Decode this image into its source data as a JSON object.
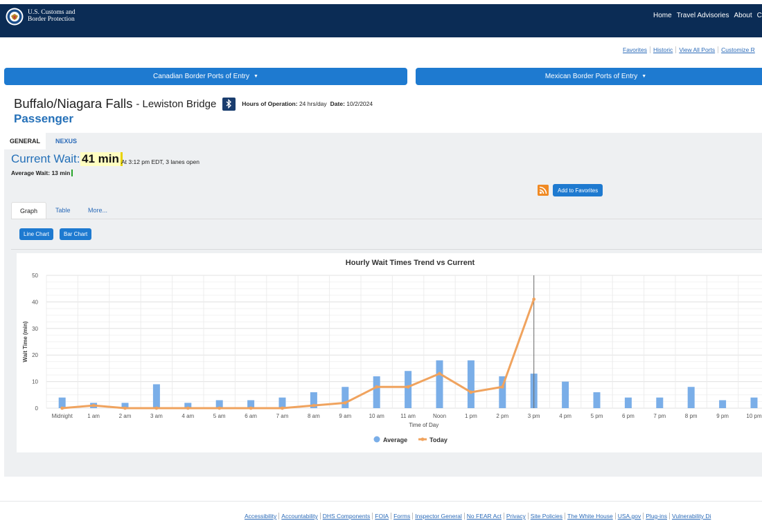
{
  "header": {
    "brand_line1": "U.S. Customs and",
    "brand_line2": "Border Protection",
    "nav": [
      "Home",
      "Travel Advisories",
      "About",
      "Co"
    ]
  },
  "utility_links": [
    "Favorites",
    "Historic",
    "View All Ports",
    "Customize R"
  ],
  "port_bars": {
    "canadian": "Canadian Border Ports of Entry",
    "mexican": "Mexican Border Ports of Entry"
  },
  "port": {
    "name": "Buffalo/Niagara Falls",
    "crossing": "- Lewiston Bridge",
    "hours_label": "Hours of Operation:",
    "hours_value": "24 hrs/day",
    "date_label": "Date:",
    "date_value": "10/2/2024",
    "lane_type": "Passenger"
  },
  "tabs": {
    "general": "GENERAL",
    "nexus": "NEXUS"
  },
  "wait": {
    "current_label": "Current Wait:",
    "current_value": "41 min",
    "meta": "At 3:12 pm EDT, 3 lanes open",
    "average_label": "Average Wait:",
    "average_value": "13 min"
  },
  "actions": {
    "add_favorites": "Add to Favorites"
  },
  "subtabs": {
    "graph": "Graph",
    "table": "Table",
    "more": "More..."
  },
  "chart_buttons": {
    "line": "Line Chart",
    "bar": "Bar Chart"
  },
  "colors": {
    "average": "#7aaee8",
    "today": "#f0a35e",
    "header": "#0b2c55",
    "accent": "#1e7ad0"
  },
  "chart_data": {
    "type": "bar",
    "title": "Hourly Wait Times Trend vs Current",
    "xlabel": "Time of Day",
    "ylabel": "Wait Time (min)",
    "ylim": [
      0,
      50
    ],
    "yticks": [
      0,
      10,
      20,
      30,
      40,
      50
    ],
    "grid": true,
    "legend": "bottom-center",
    "categories": [
      "Midnight",
      "1 am",
      "2 am",
      "3 am",
      "4 am",
      "5 am",
      "6 am",
      "7 am",
      "8 am",
      "9 am",
      "10 am",
      "11 am",
      "Noon",
      "1 pm",
      "2 pm",
      "3 pm",
      "4 pm",
      "5 pm",
      "6 pm",
      "7 pm",
      "8 pm",
      "9 pm",
      "10 pm"
    ],
    "series": [
      {
        "name": "Average",
        "type": "bar",
        "values": [
          4,
          2,
          2,
          9,
          2,
          3,
          3,
          4,
          6,
          8,
          12,
          14,
          18,
          18,
          12,
          13,
          10,
          6,
          4,
          4,
          8,
          3,
          4
        ]
      },
      {
        "name": "Today",
        "type": "line",
        "values": [
          0,
          1,
          0,
          0,
          0,
          0,
          0,
          0,
          1,
          2,
          8,
          8,
          13,
          6,
          8,
          41,
          null,
          null,
          null,
          null,
          null,
          null,
          null
        ]
      }
    ],
    "current_marker": "3 pm"
  },
  "footer_links": [
    "Accessibility",
    "Accountability",
    "DHS Components",
    "FOIA",
    "Forms",
    "Inspector General",
    "No FEAR Act",
    "Privacy",
    "Site Policies",
    "The White House",
    "USA.gov",
    "Plug-ins",
    "Vulnerability Di"
  ]
}
